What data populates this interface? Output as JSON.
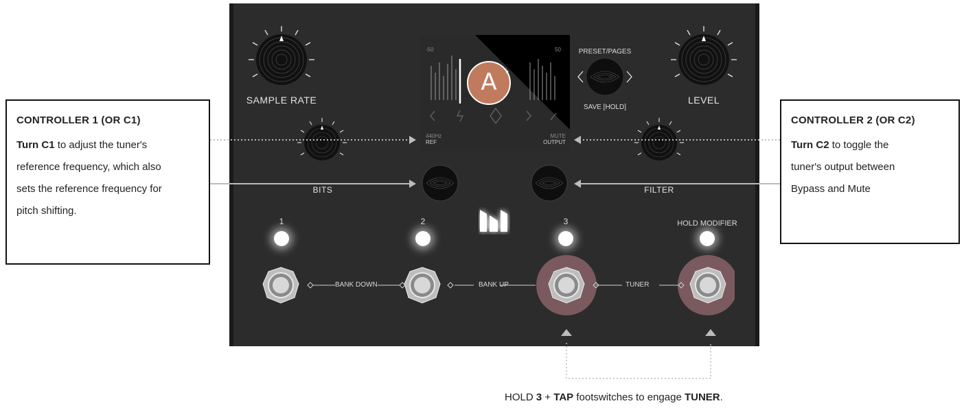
{
  "callouts": {
    "left": {
      "title": "CONTROLLER 1 (OR C1)",
      "bold": "Turn C1",
      "line1": " to adjust the tuner's",
      "line2": "reference frequency, which also",
      "line3": "sets the reference frequency for",
      "line4": "pitch shifting."
    },
    "right": {
      "title": "CONTROLLER 2 (OR C2)",
      "bold": "Turn C2",
      "line1": " to toggle the",
      "line2": "tuner's output between",
      "line3": "Bypass and Mute"
    }
  },
  "knobs": {
    "sample_rate": "SAMPLE RATE",
    "level": "LEVEL",
    "bits": "BITS",
    "filter": "FILTER"
  },
  "encoder": {
    "top": "PRESET/PAGES",
    "bottom": "SAVE [HOLD]"
  },
  "screen": {
    "left_scale": "-50",
    "right_scale": "50",
    "note": "A",
    "flat": "♭",
    "ref_value": "440Hz",
    "ref_label": "REF",
    "out_value": "MUTE",
    "out_label": "OUTPUT"
  },
  "footswitches": {
    "labels": [
      "1",
      "2",
      "3",
      "HOLD MODIFIER"
    ],
    "bank_down": "BANK DOWN",
    "bank_up": "BANK UP",
    "tuner": "TUNER"
  },
  "bottom_note": {
    "p1": "HOLD ",
    "b1": "3",
    "p2": " + ",
    "b2": "TAP",
    "p3": " footswitches to engage ",
    "b3": "TUNER",
    "p4": "."
  },
  "colors": {
    "pedal": "#2c2c2c",
    "highlight": "#7a5a5e",
    "arrow": "#bcbcbc"
  }
}
